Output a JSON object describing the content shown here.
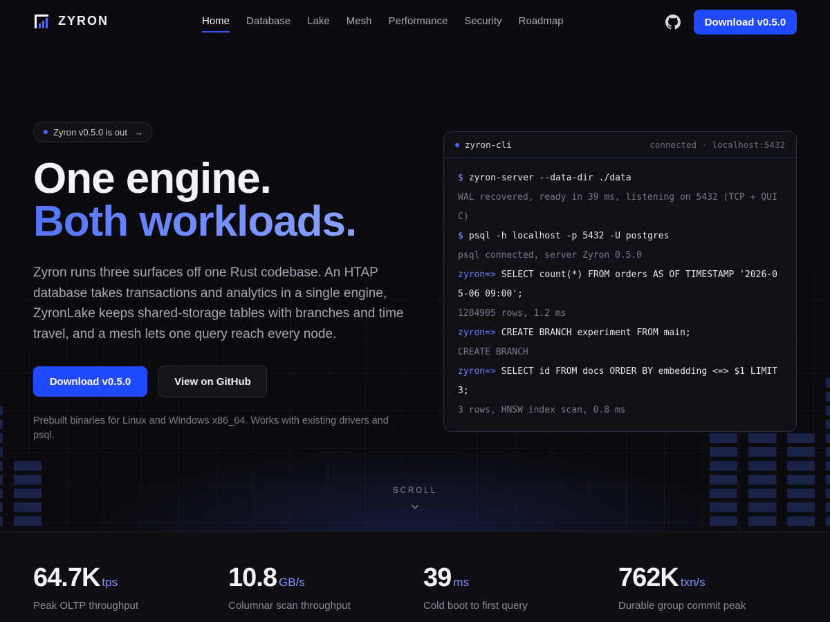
{
  "nav": {
    "brand": "ZYRON",
    "links": [
      {
        "label": "Home",
        "active": true
      },
      {
        "label": "Database"
      },
      {
        "label": "Lake"
      },
      {
        "label": "Mesh"
      },
      {
        "label": "Performance"
      },
      {
        "label": "Security"
      },
      {
        "label": "Roadmap"
      }
    ],
    "github_icon": "github-icon",
    "download_label": "Download v0.5.0"
  },
  "hero": {
    "badge": "Zyron v0.5.0 is out",
    "badge_arrow": "→",
    "headline_line1": "One engine.",
    "headline_line2": "Both workloads.",
    "lede": "Zyron runs three surfaces off one Rust codebase. An HTAP database takes transactions and analytics in a single engine, ZyronLake keeps shared-storage tables with branches and time travel, and a mesh lets one query reach every node.",
    "download_label": "Download v0.5.0",
    "github_label": "View on GitHub",
    "note": "Prebuilt binaries for Linux and Windows x86_64. Works with existing drivers and psql."
  },
  "terminal": {
    "title": "zyron-cli",
    "status": "connected · localhost:5432",
    "lines": [
      {
        "prompt": "$",
        "text": "zyron-server --data-dir ./data"
      },
      {
        "text": "WAL recovered, ready in 39 ms, listening on 5432 (TCP + QUIC)"
      },
      {
        "prompt": "$",
        "text": "psql -h localhost -p 5432 -U postgres"
      },
      {
        "text": "psql connected, server Zyron 0.5.0"
      },
      {
        "prompt": "zyron=>",
        "text": "SELECT count(*) FROM orders AS OF TIMESTAMP '2026-05-06 09:00';"
      },
      {
        "text": "1284905 rows, 1.2 ms"
      },
      {
        "prompt": "zyron=>",
        "text": "CREATE BRANCH experiment FROM main;"
      },
      {
        "text": "CREATE BRANCH"
      },
      {
        "prompt": "zyron=>",
        "text": "SELECT id FROM docs ORDER BY embedding <=> $1 LIMIT 3;"
      },
      {
        "text": "3 rows, HNSW index scan, 0.8 ms"
      }
    ]
  },
  "scroll": {
    "label": "SCROLL"
  },
  "stats": [
    {
      "value": "64.7K",
      "unit": "tps",
      "label": "Peak OLTP throughput"
    },
    {
      "value": "10.8",
      "unit": "GB/s",
      "label": "Columnar scan throughput"
    },
    {
      "value": "39",
      "unit": "ms",
      "label": "Cold boot to first query"
    },
    {
      "value": "762K",
      "unit": "txn/s",
      "label": "Durable group commit peak"
    }
  ],
  "colors": {
    "accent": "#2149ff",
    "accent_text": "#6f89ff",
    "background": "#0b0b0f"
  }
}
